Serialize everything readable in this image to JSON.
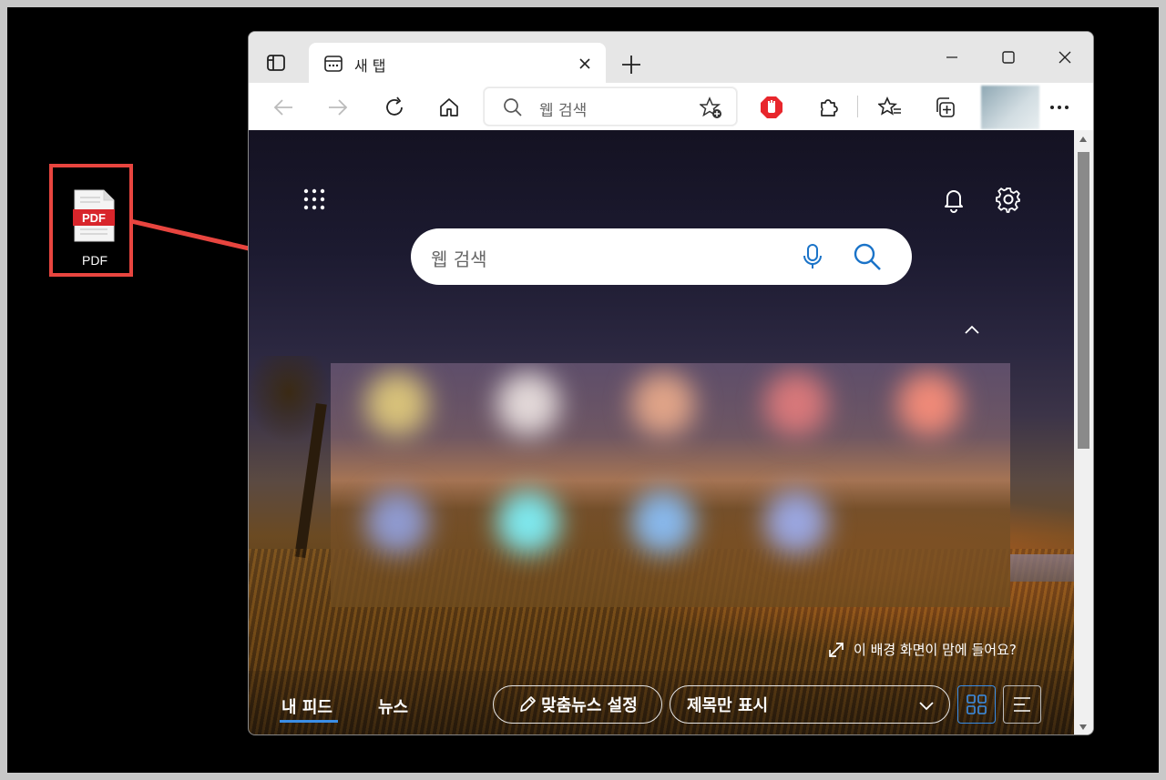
{
  "desktop": {
    "pdf_icon": {
      "badge": "PDF",
      "label": "PDF"
    }
  },
  "browser": {
    "tab": {
      "title": "새 탭"
    },
    "address_bar": {
      "placeholder": "웹 검색"
    },
    "newtab": {
      "search_placeholder": "웹 검색",
      "background_prompt": "이 배경 화면이 맘에 들어요?",
      "feed_tabs": [
        "내 피드",
        "뉴스"
      ],
      "personalize_label": "맞춤뉴스 설정",
      "layout_select": "제목만 표시"
    }
  },
  "colors": {
    "highlight": "#e8453f",
    "accent": "#3b8ee6",
    "adblock": "#e8262c"
  }
}
